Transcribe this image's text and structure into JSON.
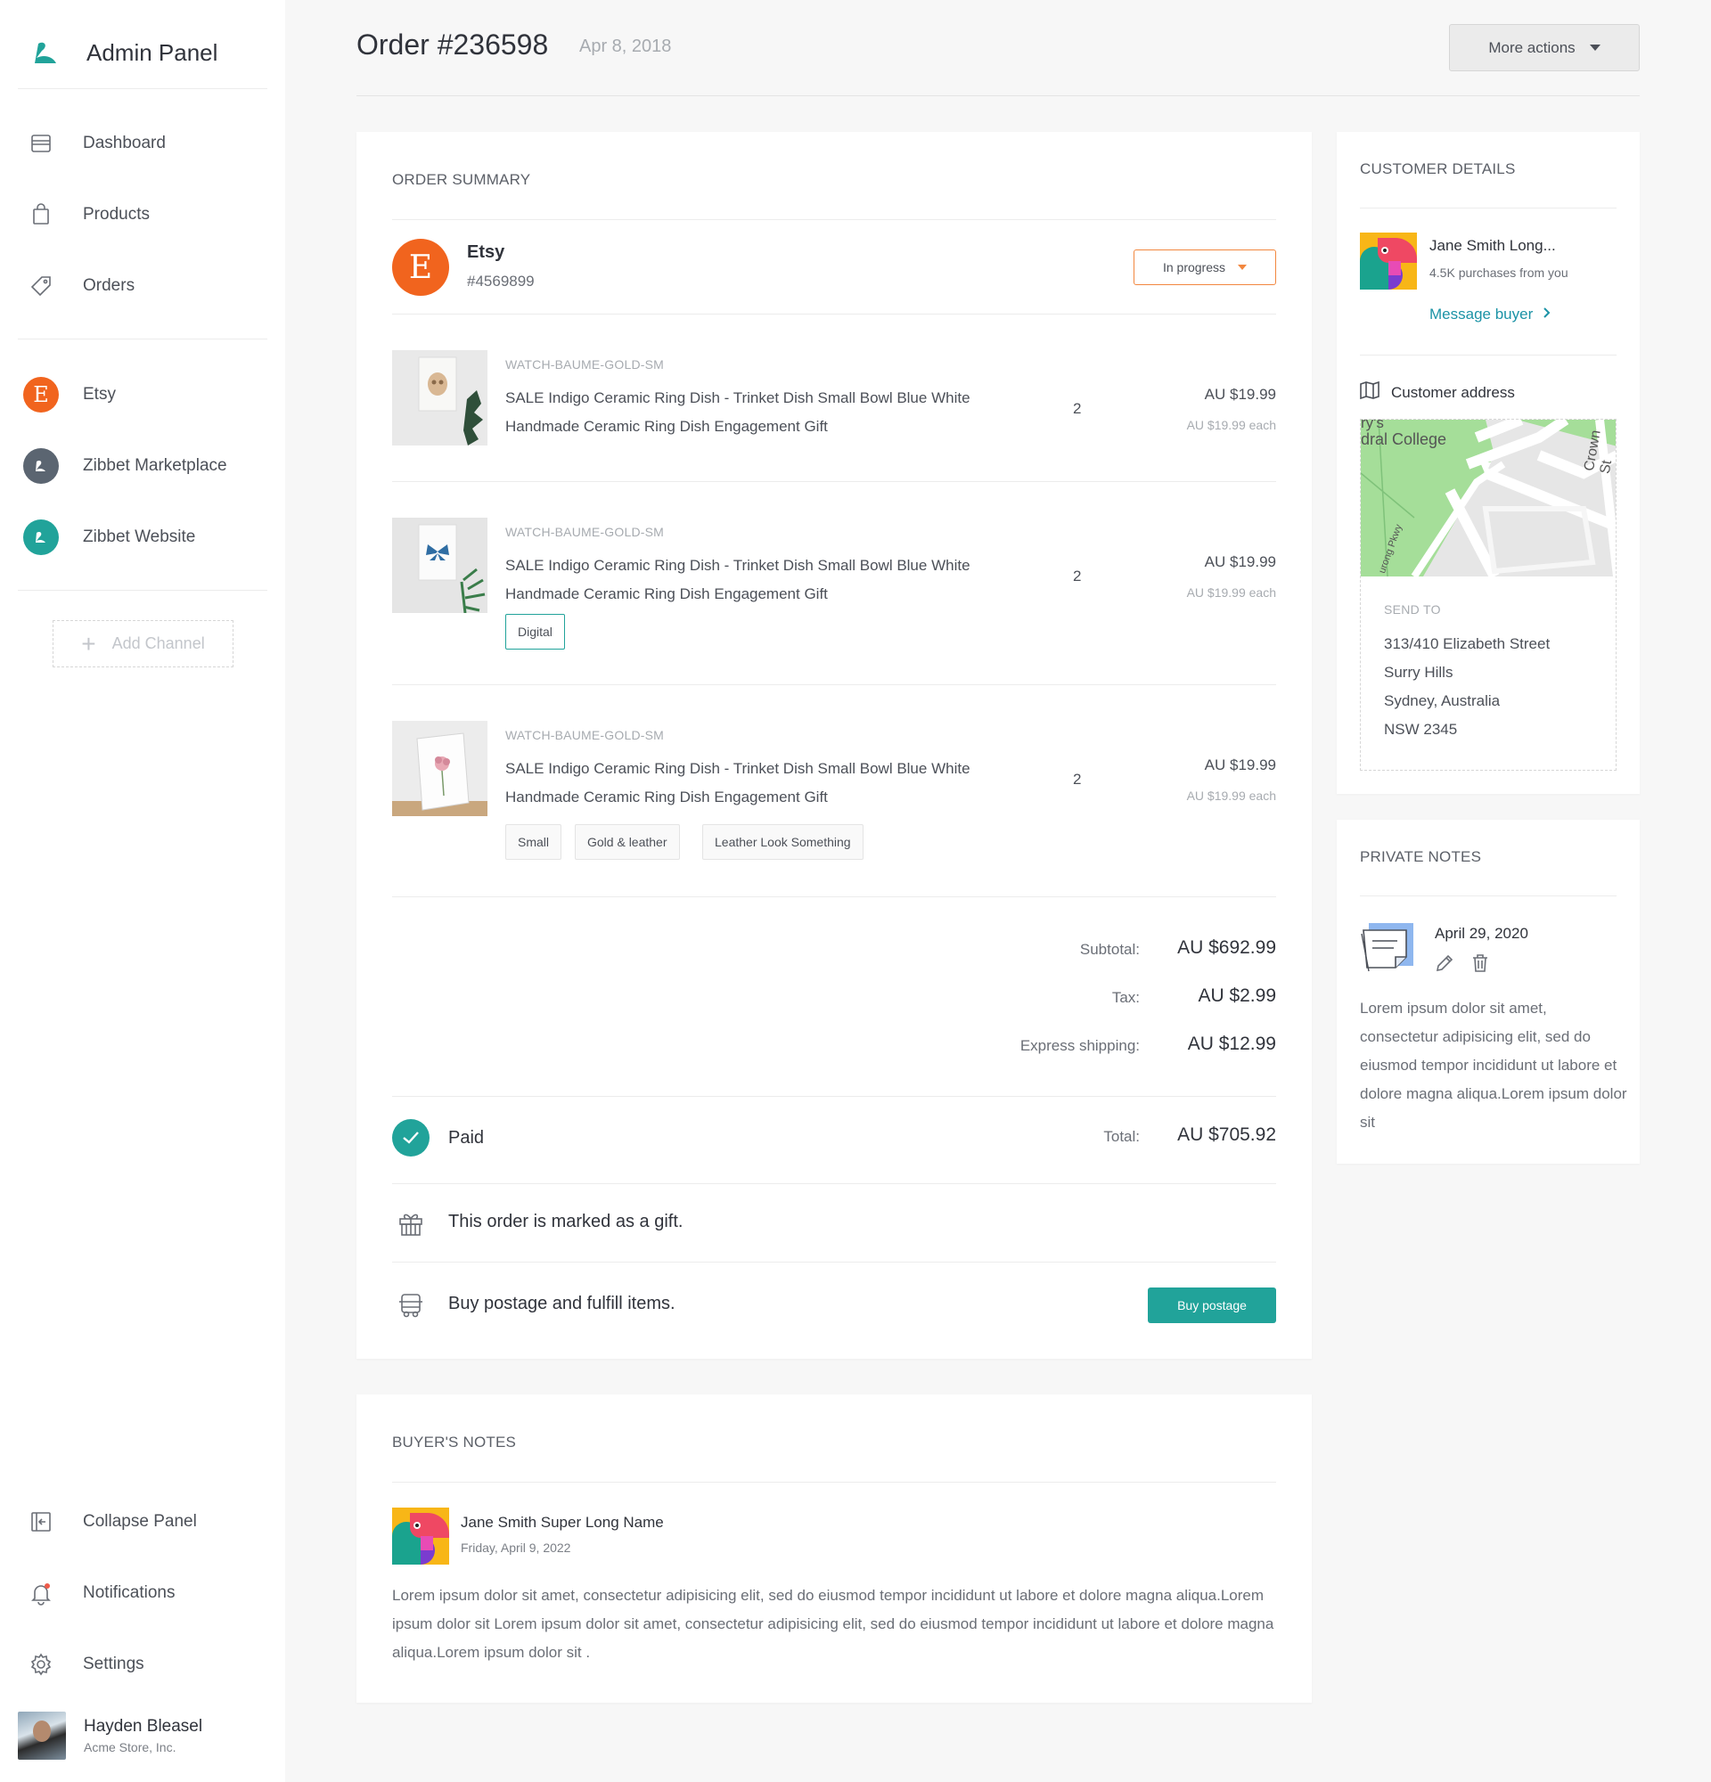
{
  "app": {
    "title": "Admin Panel"
  },
  "sidebar": {
    "nav": [
      {
        "label": "Dashboard",
        "icon": "dashboard-icon"
      },
      {
        "label": "Products",
        "icon": "shopping-bag-icon"
      },
      {
        "label": "Orders",
        "icon": "tag-icon"
      }
    ],
    "channels": [
      {
        "label": "Etsy",
        "badge": "E",
        "color": "#f1641e"
      },
      {
        "label": "Zibbet Marketplace",
        "color": "#5b6571"
      },
      {
        "label": "Zibbet Website",
        "color": "#21a39a"
      }
    ],
    "add_channel": "Add Channel",
    "bottom": [
      {
        "label": "Collapse Panel",
        "icon": "collapse-panel-icon"
      },
      {
        "label": "Notifications",
        "icon": "bell-icon"
      },
      {
        "label": "Settings",
        "icon": "gear-icon"
      }
    ],
    "user": {
      "name": "Hayden Bleasel",
      "company": "Acme Store, Inc."
    }
  },
  "header": {
    "title": "Order #236598",
    "date": "Apr 8, 2018",
    "more_actions": "More actions"
  },
  "order_summary": {
    "title": "ORDER SUMMARY",
    "channel": {
      "name": "Etsy",
      "number": "#4569899",
      "badge": "E"
    },
    "status": "In progress",
    "items": [
      {
        "sku": "WATCH-BAUME-GOLD-SM",
        "name": "SALE Indigo Ceramic Ring Dish - Trinket Dish Small Bowl Blue White Handmade Ceramic Ring Dish Engagement Gift",
        "qty": "2",
        "price": "AU $19.99",
        "each": "AU $19.99 each",
        "tags": []
      },
      {
        "sku": "WATCH-BAUME-GOLD-SM",
        "name": "SALE Indigo Ceramic Ring Dish - Trinket Dish Small Bowl Blue White Handmade Ceramic Ring Dish Engagement Gift",
        "qty": "2",
        "price": "AU $19.99",
        "each": "AU $19.99 each",
        "tags": [
          "Digital"
        ]
      },
      {
        "sku": "WATCH-BAUME-GOLD-SM",
        "name": "SALE Indigo Ceramic Ring Dish - Trinket Dish Small Bowl Blue White Handmade Ceramic Ring Dish Engagement Gift",
        "qty": "2",
        "price": "AU $19.99",
        "each": "AU $19.99 each",
        "tags": [
          "Small",
          "Gold & leather",
          "Leather Look Something"
        ]
      }
    ],
    "subtotal_label": "Subtotal:",
    "subtotal": "AU $692.99",
    "tax_label": "Tax:",
    "tax": "AU $2.99",
    "shipping_label": "Express shipping:",
    "shipping": "AU $12.99",
    "paid_label": "Paid",
    "total_label": "Total:",
    "total": "AU $705.92",
    "gift_text": "This order is marked as a gift.",
    "postage_text": "Buy postage and fulfill items.",
    "buy_postage": "Buy postage"
  },
  "buyer_notes": {
    "title": "BUYER'S NOTES",
    "author": "Jane Smith Super Long Name",
    "date": "Friday, April 9, 2022",
    "text": "Lorem ipsum dolor sit amet, consectetur adipisicing elit, sed do eiusmod tempor incididunt ut labore et dolore magna aliqua.Lorem ipsum dolor sit Lorem ipsum dolor sit amet, consectetur adipisicing elit, sed do eiusmod tempor incididunt ut labore et dolore magna aliqua.Lorem ipsum dolor sit ."
  },
  "customer": {
    "title": "CUSTOMER DETAILS",
    "name": "Jane Smith Long...",
    "purchases": "4.5K purchases from you",
    "message": "Message buyer",
    "address_title": "Customer address",
    "map_labels": {
      "college": "dral College",
      "college_top": "ry's",
      "crown": "Crown St",
      "parkway": "urong Pkwy"
    },
    "send_to": "SEND TO",
    "address": [
      "313/410 Elizabeth Street",
      "Surry Hills",
      "Sydney, Australia",
      "NSW 2345"
    ]
  },
  "private_notes": {
    "title": "PRIVATE NOTES",
    "date": "April 29, 2020",
    "text": "Lorem ipsum dolor sit amet, consectetur adipisicing elit, sed do eiusmod tempor incididunt ut labore et dolore magna aliqua.Lorem ipsum dolor sit"
  },
  "colors": {
    "teal": "#21a39a",
    "etsy": "#f1641e",
    "link": "#1c93a6",
    "status_border": "#f2873f"
  }
}
